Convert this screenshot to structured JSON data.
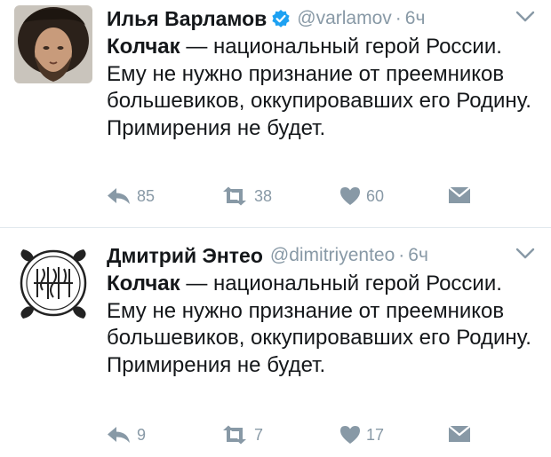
{
  "tweets": [
    {
      "author_name": "Илья Варламов",
      "verified": true,
      "handle": "@varlamov",
      "separator": "·",
      "time": "6ч",
      "text_bold": "Колчак",
      "text_rest": " — национальный герой России. Ему не нужно признание от преемников большевиков, оккупировавших его Родину. Примирения не будет.",
      "replies": "85",
      "retweets": "38",
      "likes": "60"
    },
    {
      "author_name": "Дмитрий Энтео",
      "verified": false,
      "handle": "@dimitriyenteo",
      "separator": "·",
      "time": "6ч",
      "text_bold": "Колчак",
      "text_rest": " — национальный герой России. Ему не нужно признание от преемников большевиков, оккупировавших его Родину. Примирения не будет.",
      "replies": "9",
      "retweets": "7",
      "likes": "17"
    }
  ],
  "icons": {
    "reply": "reply-icon",
    "retweet": "retweet-icon",
    "like": "heart-icon",
    "dm": "envelope-icon",
    "more": "chevron-down-icon",
    "verified": "verified-badge-icon"
  },
  "colors": {
    "text": "#14171a",
    "muted": "#8899a6",
    "verified": "#1da1f2",
    "divider": "#e1e8ed"
  }
}
